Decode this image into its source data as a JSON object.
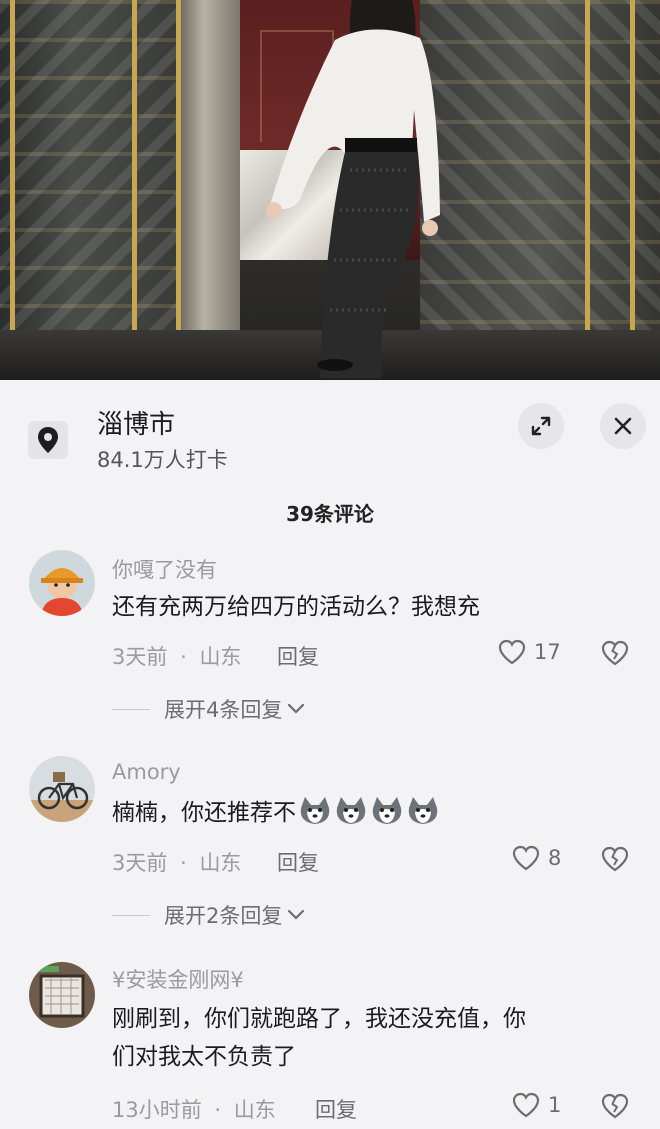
{
  "location": {
    "city": "淄博市",
    "checkins": "84.1万人打卡"
  },
  "comments_header": {
    "title": "39条评论"
  },
  "comments": [
    {
      "username": "你嘎了没有",
      "text": "还有充两万给四万的活动么？我想充",
      "time": "3天前",
      "region": "山东",
      "reply_label": "回复",
      "likes": "17",
      "expand_label": "展开4条回复"
    },
    {
      "username": "Amory",
      "text": "楠楠，你还推荐不",
      "emojis": [
        "husky-emoji",
        "husky-emoji",
        "husky-emoji",
        "husky-emoji"
      ],
      "time": "3天前",
      "region": "山东",
      "reply_label": "回复",
      "likes": "8",
      "expand_label": "展开2条回复"
    },
    {
      "username": "¥安装金刚网¥",
      "text_line1": "刚刷到，你们就跑路了，我还没充值，你",
      "text_line2": "们对我太不负责了",
      "time": "13小时前",
      "region": "山东",
      "reply_label": "回复",
      "likes": "1"
    }
  ],
  "meta_separator": "·",
  "icons": {
    "location": "location-pin-icon",
    "expand": "expand-arrows-icon",
    "close": "close-icon",
    "like": "heart-outline-icon",
    "dislike": "broken-heart-icon",
    "chevron": "chevron-down-icon"
  },
  "colors": {
    "sheet_bg": "#f3f3f5",
    "muted_text": "#9a9aa0",
    "primary_text": "#1c1c1c"
  }
}
